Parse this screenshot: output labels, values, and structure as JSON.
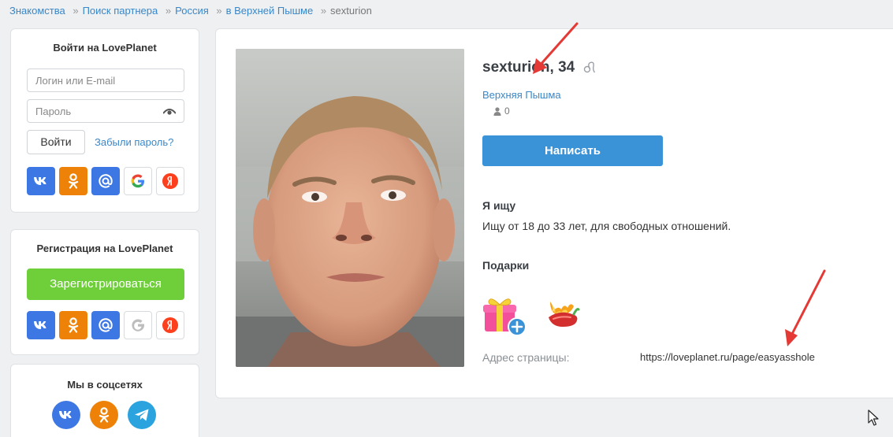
{
  "breadcrumb": {
    "items": [
      "Знакомства",
      "Поиск партнера",
      "Россия",
      "в Верхней Пышме"
    ],
    "current": "sexturion",
    "separator": "»"
  },
  "login": {
    "title": "Войти на LovePlanet",
    "login_placeholder": "Логин или E-mail",
    "password_placeholder": "Пароль",
    "submit_label": "Войти",
    "forgot_label": "Забыли пароль?"
  },
  "register": {
    "title": "Регистрация на LovePlanet",
    "button_label": "Зарегистрироваться"
  },
  "social": {
    "title": "Мы в соцсетях"
  },
  "profile": {
    "name": "sexturion, 34",
    "city": "Верхняя Пышма",
    "visits": "0",
    "write_button": "Написать",
    "seeking_heading": "Я ищу",
    "seeking_text": "Ищу от 18 до 33 лет, для свободных отношений.",
    "gifts_heading": "Подарки",
    "address_label": "Адрес страницы:",
    "address_value": "https://loveplanet.ru/page/easyasshole"
  },
  "colors": {
    "link": "#3a87c8",
    "write_button": "#3a93d7",
    "register_button": "#6fcf3a",
    "vk": "#3d77e3",
    "ok": "#ee8208",
    "telegram": "#2aa3df",
    "annotation_arrow": "#e53935"
  }
}
